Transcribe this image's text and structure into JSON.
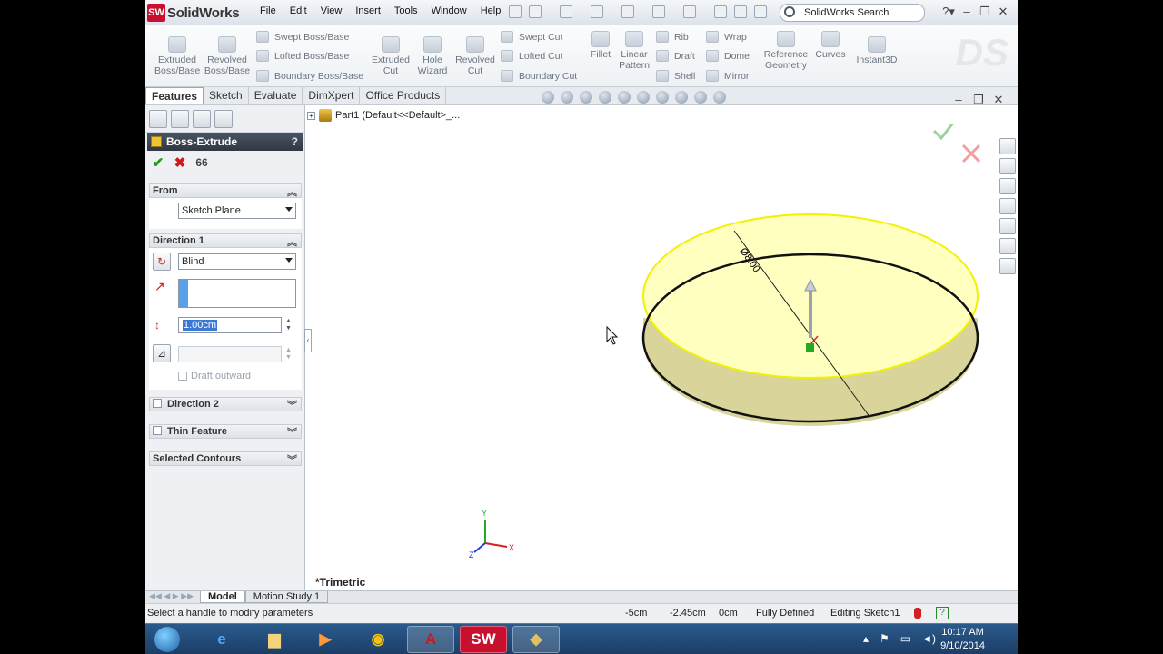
{
  "app": {
    "logo_text": "SolidWorks",
    "logo_badge": "SW"
  },
  "menus": [
    "File",
    "Edit",
    "View",
    "Insert",
    "Tools",
    "Window",
    "Help"
  ],
  "search": {
    "label": "SolidWorks Search"
  },
  "ribbon": {
    "extruded_boss": "Extruded Boss/Base",
    "revolved_boss": "Revolved Boss/Base",
    "swept_boss": "Swept Boss/Base",
    "lofted_boss": "Lofted Boss/Base",
    "boundary_boss": "Boundary Boss/Base",
    "extruded_cut": "Extruded Cut",
    "hole_wizard": "Hole Wizard",
    "revolved_cut": "Revolved Cut",
    "swept_cut": "Swept Cut",
    "lofted_cut": "Lofted Cut",
    "boundary_cut": "Boundary Cut",
    "fillet": "Fillet",
    "linear_pattern": "Linear Pattern",
    "rib": "Rib",
    "draft": "Draft",
    "shell": "Shell",
    "wrap": "Wrap",
    "dome": "Dome",
    "mirror": "Mirror",
    "reference_geometry": "Reference Geometry",
    "curves": "Curves",
    "instant3d": "Instant3D"
  },
  "tabs": [
    "Features",
    "Sketch",
    "Evaluate",
    "DimXpert",
    "Office Products"
  ],
  "tree": {
    "label": "Part1  (Default<<Default>_..."
  },
  "pm": {
    "title": "Boss-Extrude",
    "help": "?",
    "from": {
      "header": "From",
      "value": "Sketch Plane"
    },
    "direction1": {
      "header": "Direction 1",
      "end_condition": "Blind",
      "depth": "1.00cm",
      "draft_outward": "Draft outward"
    },
    "direction2": {
      "header": "Direction 2"
    },
    "thin_feature": {
      "header": "Thin Feature"
    },
    "selected_contours": {
      "header": "Selected Contours"
    }
  },
  "viewport": {
    "dimension_label": "Ø8.00",
    "view_name": "*Trimetric",
    "triad": {
      "x": "X",
      "y": "Y",
      "z": "Z"
    }
  },
  "bottom_tabs": [
    "Model",
    "Motion Study 1"
  ],
  "status": {
    "message": "Select a handle to modify parameters",
    "x": "-5cm",
    "y": "-2.45cm",
    "z": "0cm",
    "state": "Fully Defined",
    "editing": "Editing Sketch1",
    "help": "?"
  },
  "taskbar": {
    "time": "10:17 AM",
    "date": "9/10/2014"
  },
  "colors": {
    "accent": "#c8102e",
    "part_face": "#ffffc0",
    "part_edge": "#f2f200",
    "taskbar": "#1c3e66"
  }
}
